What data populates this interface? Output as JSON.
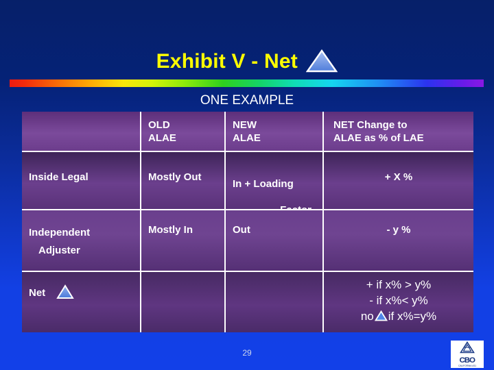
{
  "slide": {
    "title": "Exhibit V - Net",
    "subtitle": "ONE EXAMPLE",
    "page_number": "29",
    "colors": {
      "title_text": "#ffff00",
      "subtitle_text": "#ffffff",
      "background_top": "#062069",
      "background_bottom": "#1240e8",
      "table_purple": "#6b3f8d",
      "triangle_fill": "#5b86e0",
      "triangle_outline": "#ffffff"
    },
    "icons": {
      "title_triangle": "delta-triangle-icon",
      "net_triangle": "delta-triangle-icon",
      "inline_triangle": "delta-triangle-icon"
    }
  },
  "table": {
    "headers": [
      "",
      "OLD\nALAE",
      "NEW\nALAE",
      "NET Change to\nALAE as % of LAE"
    ],
    "header_cells": {
      "col0": "",
      "col1_line1": "OLD",
      "col1_line2": "ALAE",
      "col2_line1": "NEW",
      "col2_line2": "ALAE",
      "col3_line1": "NET Change to",
      "col3_line2": "ALAE as % of LAE"
    },
    "rows": [
      {
        "label": "Inside Legal",
        "label_line2": "",
        "old_alae": "Mostly Out",
        "new_alae_line1": "In + Loading",
        "new_alae_line2": "Factor",
        "net_change": "+ X %"
      },
      {
        "label": "Independent",
        "label_line2": "Adjuster",
        "old_alae": "Mostly In",
        "new_alae_line1": "Out",
        "new_alae_line2": "",
        "net_change": "- y %"
      },
      {
        "label": "Net",
        "label_line2": "",
        "old_alae": "",
        "new_alae_line1": "",
        "new_alae_line2": "",
        "net_line1": "+ if x% > y%",
        "net_line2": "-  if x%< y%",
        "net_line3_pre": "no",
        "net_line3_post": "if x%=y%"
      }
    ]
  },
  "logo": {
    "wordmark": "CBO",
    "subtext": "CALIFORNIA 4/11"
  }
}
